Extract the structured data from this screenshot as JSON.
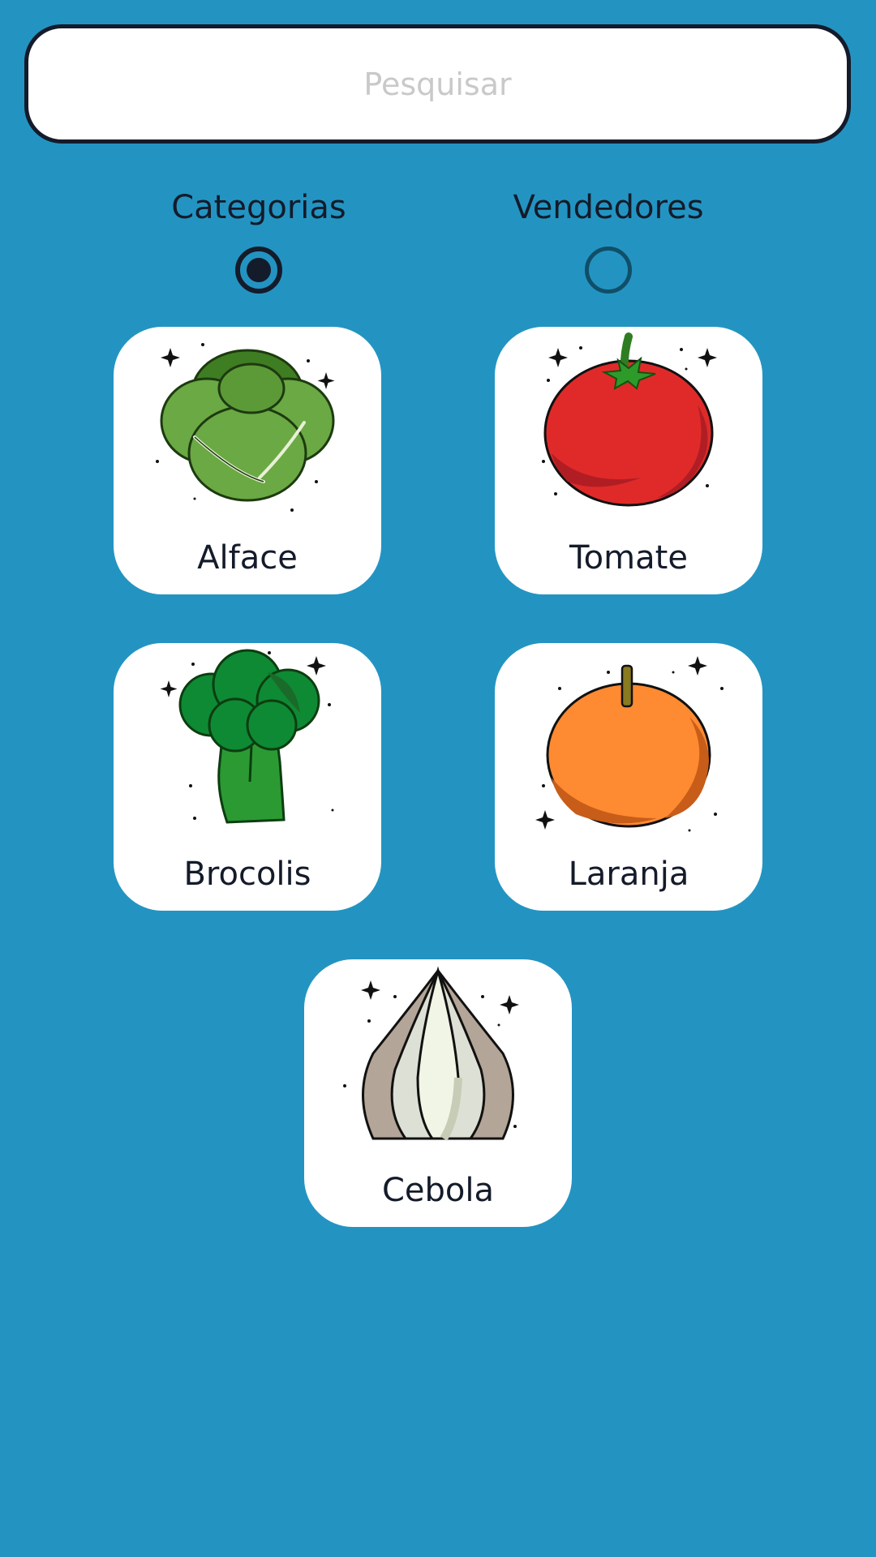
{
  "search": {
    "placeholder": "Pesquisar",
    "value": ""
  },
  "filters": {
    "selected": "categorias",
    "items": [
      {
        "label": "Categorias",
        "checked": true
      },
      {
        "label": "Vendedores",
        "checked": false
      }
    ]
  },
  "products": [
    {
      "label": "Alface",
      "icon": "lettuce-icon"
    },
    {
      "label": "Tomate",
      "icon": "tomato-icon"
    },
    {
      "label": "Brocolis",
      "icon": "broccoli-icon"
    },
    {
      "label": "Laranja",
      "icon": "orange-icon"
    },
    {
      "label": "Cebola",
      "icon": "onion-icon"
    }
  ],
  "colors": {
    "background": "#2394c2",
    "card": "#ffffff",
    "text": "#141b2a",
    "radio_unchecked": "#104f68",
    "placeholder": "#c9c9c9"
  }
}
